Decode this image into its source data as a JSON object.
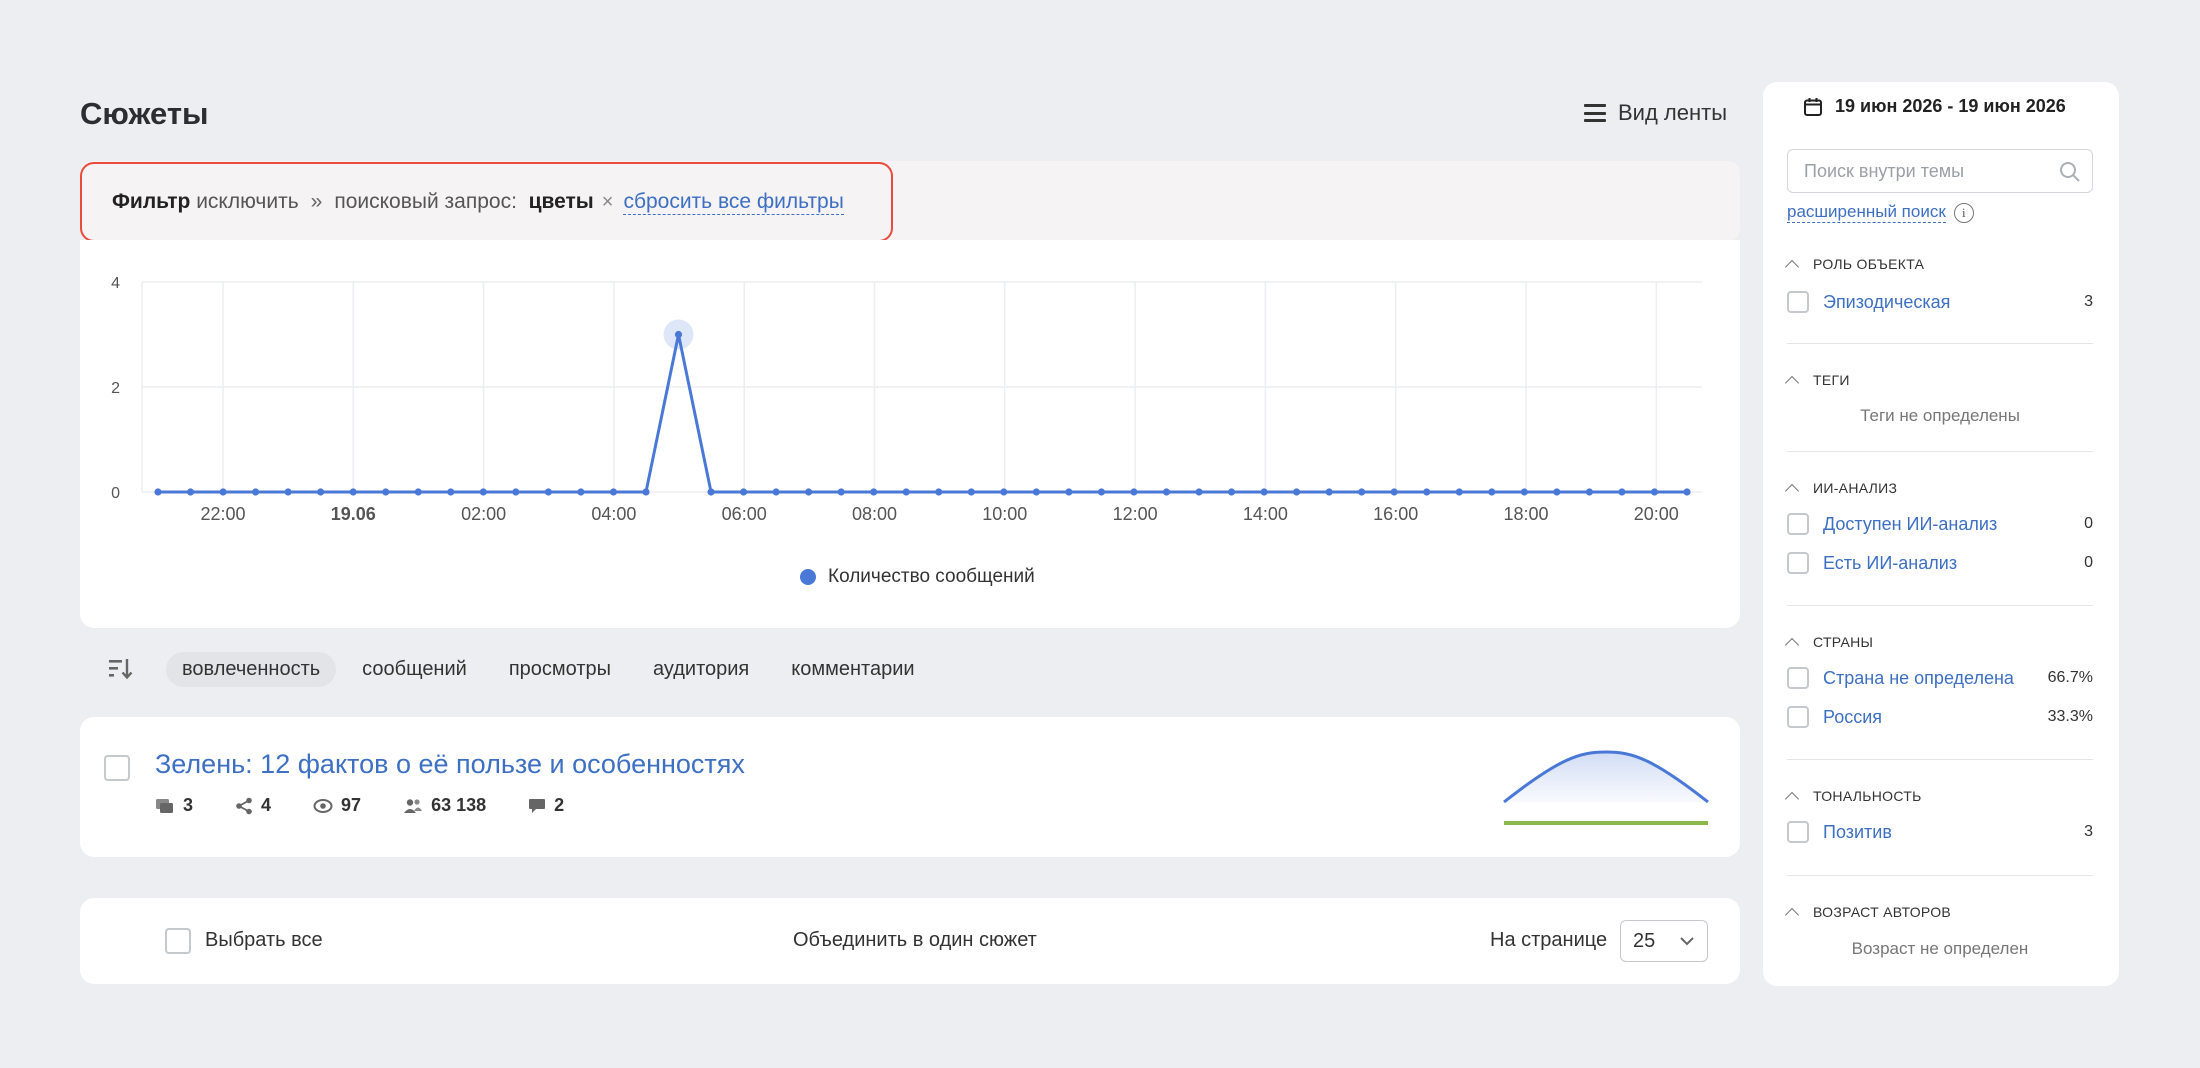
{
  "page": {
    "title": "Сюжеты",
    "view_toggle_label": "Вид ленты"
  },
  "filter": {
    "label": "Фильтр",
    "mode": "исключить",
    "separator": "»",
    "query_label": "поисковый запрос:",
    "query_value": "цветы",
    "remove_glyph": "×",
    "reset_label": "сбросить все фильтры"
  },
  "chart_data": {
    "type": "line",
    "x_tick_labels": [
      "22:00",
      "19.06",
      "02:00",
      "04:00",
      "06:00",
      "08:00",
      "10:00",
      "12:00",
      "14:00",
      "16:00",
      "18:00",
      "20:00"
    ],
    "y_tick_labels": [
      "4",
      "2",
      "0"
    ],
    "ylim": [
      0,
      4
    ],
    "grid": true,
    "legend_position": "bottom",
    "series": [
      {
        "name": "Количество сообщений",
        "color": "#4a78d6",
        "values": [
          0,
          0,
          0,
          0,
          0,
          0,
          0,
          0,
          0,
          0,
          0,
          0,
          0,
          0,
          0,
          0,
          3,
          0,
          0,
          0,
          0,
          0,
          0,
          0,
          0,
          0,
          0,
          0,
          0,
          0,
          0,
          0,
          0,
          0,
          0,
          0,
          0,
          0,
          0,
          0,
          0,
          0,
          0,
          0,
          0,
          0,
          0,
          0
        ]
      }
    ],
    "highlight_index": 16
  },
  "sort": {
    "options": [
      "вовлеченность",
      "сообщений",
      "просмотры",
      "аудитория",
      "комментарии"
    ],
    "active_index": 0
  },
  "story": {
    "title": "Зелень: 12 фактов о её пользе и особенностях",
    "stats": {
      "messages": "3",
      "reposts": "4",
      "views": "97",
      "audience": "63 138",
      "comments": "2"
    },
    "sparkline_color": "#4a78d6",
    "tone_color": "#8ab84a"
  },
  "footer": {
    "select_all": "Выбрать все",
    "merge": "Объединить в один сюжет",
    "per_page_label": "На странице",
    "per_page_value": "25"
  },
  "sidebar": {
    "date_range": "19 июн 2026 - 19 июн 2026",
    "search_placeholder": "Поиск внутри темы",
    "advanced_search": "расширенный поиск",
    "info_glyph": "i",
    "sections": {
      "role": {
        "title": "РОЛЬ ОБЪЕКТА",
        "items": [
          {
            "label": "Эпизодическая",
            "count": "3"
          }
        ]
      },
      "tags": {
        "title": "ТЕГИ",
        "empty": "Теги не определены"
      },
      "ai": {
        "title": "ИИ-АНАЛИЗ",
        "items": [
          {
            "label": "Доступен ИИ-анализ",
            "count": "0"
          },
          {
            "label": "Есть ИИ-анализ",
            "count": "0"
          }
        ]
      },
      "countries": {
        "title": "СТРАНЫ",
        "items": [
          {
            "label": "Страна не определена",
            "count": "66.7%"
          },
          {
            "label": "Россия",
            "count": "33.3%"
          }
        ]
      },
      "tone": {
        "title": "ТОНАЛЬНОСТЬ",
        "items": [
          {
            "label": "Позитив",
            "count": "3"
          }
        ]
      },
      "age": {
        "title": "ВОЗРАСТ АВТОРОВ",
        "empty": "Возраст не определен"
      }
    }
  },
  "colors": {
    "accent": "#3d6fc2",
    "highlight_border": "#e94b3c",
    "background": "#eceef1"
  }
}
